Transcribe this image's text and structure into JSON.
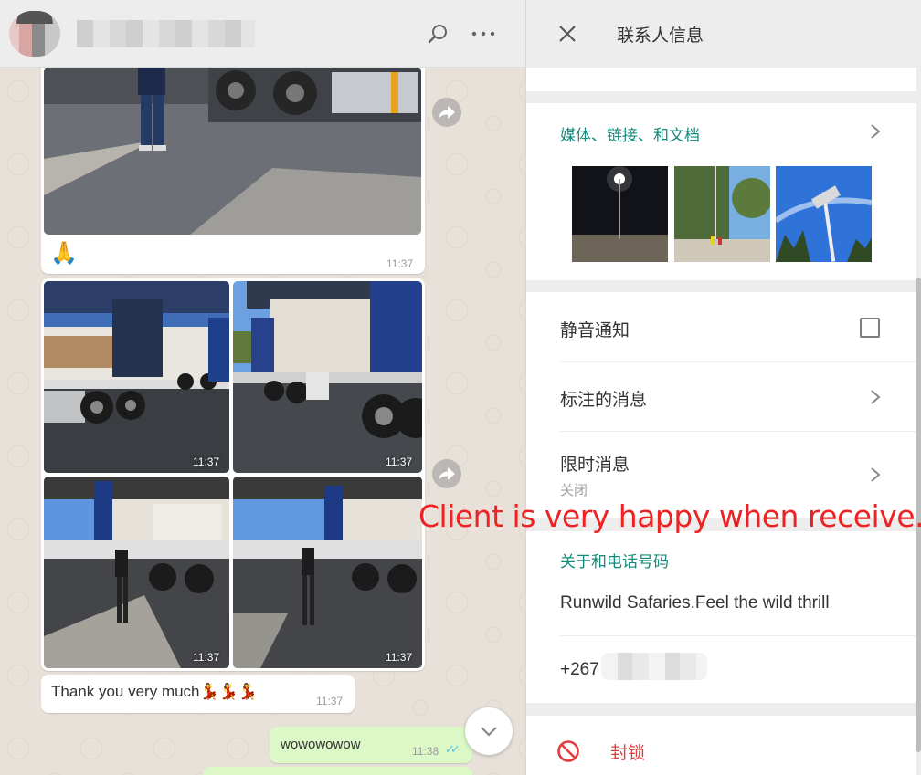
{
  "chat": {
    "messages": {
      "prayer_emoji": "🙏",
      "prayer_time": "11:37",
      "grid_times": [
        "11:37",
        "11:37",
        "11:37",
        "11:37"
      ],
      "thanks_text": "Thank you very much💃💃💃",
      "thanks_time": "11:37",
      "wow_text": "wowowowow",
      "wow_time": "11:38",
      "wow_ticks": "✓✓"
    }
  },
  "info": {
    "title": "联系人信息",
    "media_label": "媒体、链接、和文档",
    "mute_label": "静音通知",
    "starred_label": "标注的消息",
    "disappearing_label": "限时消息",
    "disappearing_value": "关闭",
    "about_label": "关于和电话号码",
    "about_text": "Runwild Safaries.Feel the wild thrill",
    "phone_prefix": "+267",
    "block_label": "封锁"
  },
  "overlay": {
    "caption": "Client is very happy when receive."
  },
  "icons": {
    "search": "search-icon",
    "menu": "more-dots-icon",
    "close": "close-icon",
    "forward": "forward-icon",
    "chevron": "chevron-right-icon",
    "block": "block-icon",
    "scroll": "chevron-down-icon"
  },
  "colors": {
    "accent": "#15897a",
    "danger": "#e33b3b",
    "outgoing_bubble": "#dcf8c6",
    "read_ticks": "#4fc3f7"
  }
}
